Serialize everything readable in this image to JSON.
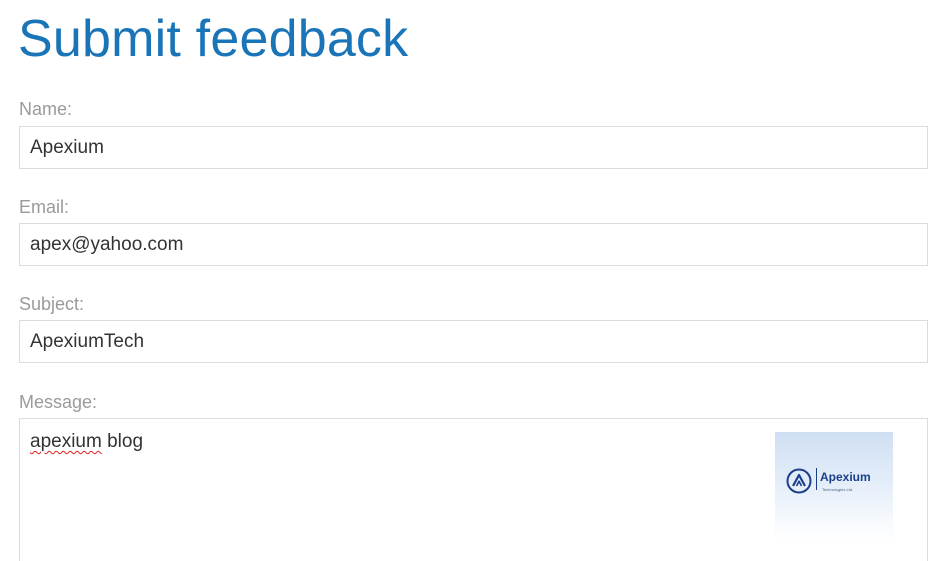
{
  "page": {
    "title": "Submit feedback"
  },
  "form": {
    "name": {
      "label": "Name:",
      "value": "Apexium"
    },
    "email": {
      "label": "Email:",
      "value": "apex@yahoo.com"
    },
    "subject": {
      "label": "Subject:",
      "value": "ApexiumTech"
    },
    "message": {
      "label": "Message:",
      "value_misspelled_word": "apexium",
      "value_rest": " blog"
    }
  },
  "attachment": {
    "logo_text": "Apexium",
    "logo_subtext": "Technologies Ltd.",
    "logo_icon": "apexium-logo-icon",
    "brand_color": "#1b3f8a"
  },
  "colors": {
    "title": "#1a74b8",
    "label": "#9a9a9a",
    "border": "#dcdcdc",
    "spellcheck": "#e02020"
  }
}
